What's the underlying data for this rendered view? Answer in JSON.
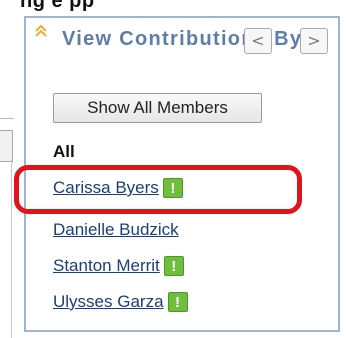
{
  "background_heading": "ng e   pp",
  "panel": {
    "title": "View Contributions By:",
    "prev_button": "<",
    "next_button": ">",
    "show_all_label": "Show All Members",
    "all_label": "All",
    "members": [
      {
        "name": "Carissa Byers",
        "has_flag": true,
        "flag_text": "!",
        "highlighted": true
      },
      {
        "name": "Danielle Budzick",
        "has_flag": false
      },
      {
        "name": "Stanton Merrit",
        "has_flag": true,
        "flag_text": "!"
      },
      {
        "name": "Ulysses Garza",
        "has_flag": true,
        "flag_text": "!"
      }
    ]
  },
  "colors": {
    "panel_border": "#9fb4cf",
    "title_text": "#5f7ea7",
    "link_text": "#1a3f7a",
    "flag_green": "#6fbe3e",
    "highlight_red": "#e0141b",
    "collapse_arrow": "#e3b53a"
  },
  "icons": {
    "collapse": "double-chevron-up-icon",
    "flag": "exclamation-flag-icon"
  }
}
